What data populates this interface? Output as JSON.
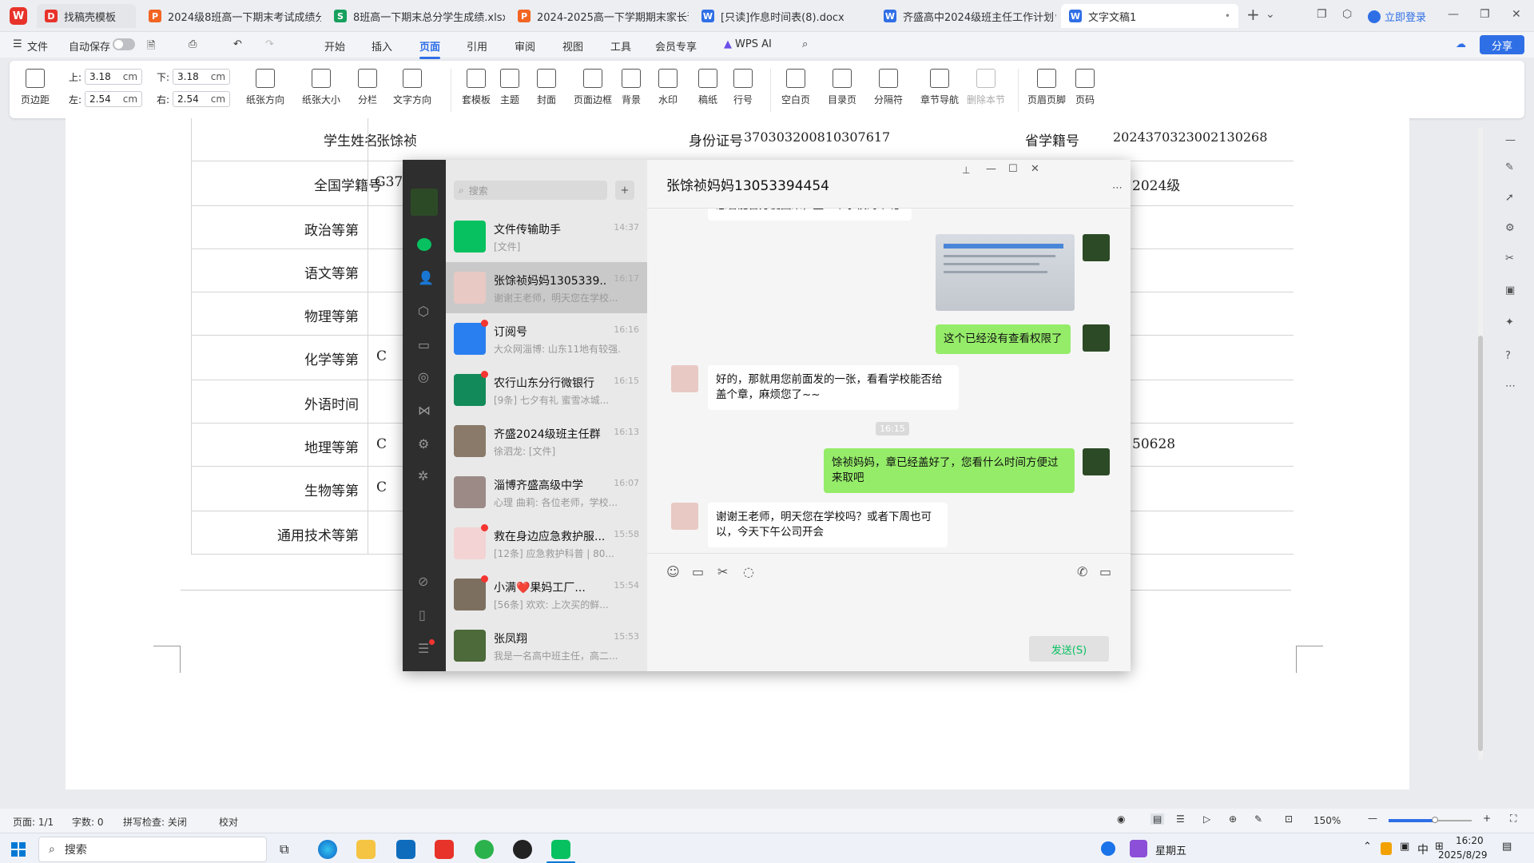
{
  "tabs": [
    {
      "label": "找稿壳模板",
      "icon": "wps-red-icon"
    },
    {
      "label": "2024级8班高一下期末考试成绩分析",
      "icon": "ppt-icon"
    },
    {
      "label": "8班高一下期末总分学生成绩.xlsx",
      "icon": "sheet-icon"
    },
    {
      "label": "2024-2025高一下学期期末家长课",
      "icon": "ppt-icon"
    },
    {
      "label": "[只读]作息时间表(8).docx",
      "icon": "word-icon"
    },
    {
      "label": "齐盛高中2024级班主任工作计划",
      "icon": "word-icon"
    },
    {
      "label": "文字文稿1",
      "icon": "word-icon"
    }
  ],
  "login": "立即登录",
  "menu": {
    "file": "文件",
    "autosave": "自动保存",
    "items": [
      "开始",
      "插入",
      "页面",
      "引用",
      "审阅",
      "视图",
      "工具",
      "会员专享"
    ],
    "wps_ai": "WPS AI",
    "share": "分享"
  },
  "ribbon": {
    "margin": "页边距",
    "top_label": "上:",
    "top_val": "3.18",
    "bottom_label": "下:",
    "bottom_val": "3.18",
    "left_label": "左:",
    "left_val": "2.54",
    "right_label": "右:",
    "right_val": "2.54",
    "unit": "cm",
    "buttons": [
      "纸张方向",
      "纸张大小",
      "分栏",
      "文字方向",
      "套模板",
      "主题",
      "封面",
      "页面边框",
      "背景",
      "水印",
      "稿纸",
      "行号",
      "空白页",
      "目录页",
      "分隔符",
      "章节导航",
      "删除本节",
      "页眉页脚",
      "页码"
    ]
  },
  "table": {
    "row1": {
      "l1": "学生姓名",
      "v1": "张馀祯",
      "l2": "身份证号",
      "v2": "370303200810307617",
      "l3": "省学籍号",
      "v3": "2024370323002130268"
    },
    "row2": {
      "label": "全国学籍号",
      "v1": "G3703",
      "v3": "2024级"
    },
    "labels": [
      "政治等第",
      "语文等第",
      "物理等第",
      "化学等第",
      "外语时间",
      "地理等第",
      "生物等第",
      "通用技术等第"
    ],
    "values": [
      "",
      "",
      "",
      "C",
      "",
      "C",
      "C",
      ""
    ],
    "row_geo_right": "50628"
  },
  "wechat": {
    "search_placeholder": "搜索",
    "chat_title": "张馀祯妈妈13053394454",
    "chats": [
      {
        "name": "文件传输助手",
        "time": "14:37",
        "preview": "[文件]",
        "color": "#07c160"
      },
      {
        "name": "张馀祯妈妈1305339...",
        "time": "16:17",
        "preview": "谢谢王老师，明天您在学校...",
        "color": "#e9c9c4"
      },
      {
        "name": "订阅号",
        "time": "16:16",
        "preview": "大众网淄博: 山东11地有较强...",
        "color": "#2a7ff0"
      },
      {
        "name": "农行山东分行微银行",
        "time": "16:15",
        "preview": "[9条] 七夕有礼 蜜雪冰城...",
        "color": "#128a5a"
      },
      {
        "name": "齐盛2024级班主任群",
        "time": "16:13",
        "preview": "徐泗龙: [文件]",
        "color": "#8a7a6a"
      },
      {
        "name": "淄博齐盛高级中学",
        "time": "16:07",
        "preview": "心理 曲莉: 各位老师，学校...",
        "color": "#9b8a86"
      },
      {
        "name": "救在身边应急救护服...",
        "time": "15:58",
        "preview": "[12条] 应急救护科普 | 80...",
        "color": "#f3d3d3"
      },
      {
        "name": "小满❤️果妈工厂...",
        "time": "15:54",
        "preview": "[56条] 欢欢: 上次买的鲜...",
        "color": "#7d6f60"
      },
      {
        "name": "张凤翔",
        "time": "15:53",
        "preview": "我是一名高中班主任，高二...",
        "color": "#4c6a3a"
      }
    ],
    "messages": {
      "m0": "您看能否方便回来，盖一个学校的章呢?",
      "m1": "这个已经没有查看权限了",
      "m2": "好的，那就用您前面发的一张，看看学校能否给盖个章，麻烦您了~~",
      "time": "16:15",
      "m3": "馀祯妈妈，章已经盖好了，您看什么时间方便过来取吧",
      "m4": "谢谢王老师，明天您在学校吗？或者下周也可以，今天下午公司开会"
    },
    "send": "发送(S)"
  },
  "status": {
    "page": "页面: 1/1",
    "words": "字数: 0",
    "spell": "拼写检查: 关闭",
    "proof": "校对",
    "zoom": "150%"
  },
  "taskbar": {
    "search": "搜索",
    "weekday": "星期五",
    "ime": "中",
    "time": "16:20",
    "date": "2025/8/29"
  }
}
